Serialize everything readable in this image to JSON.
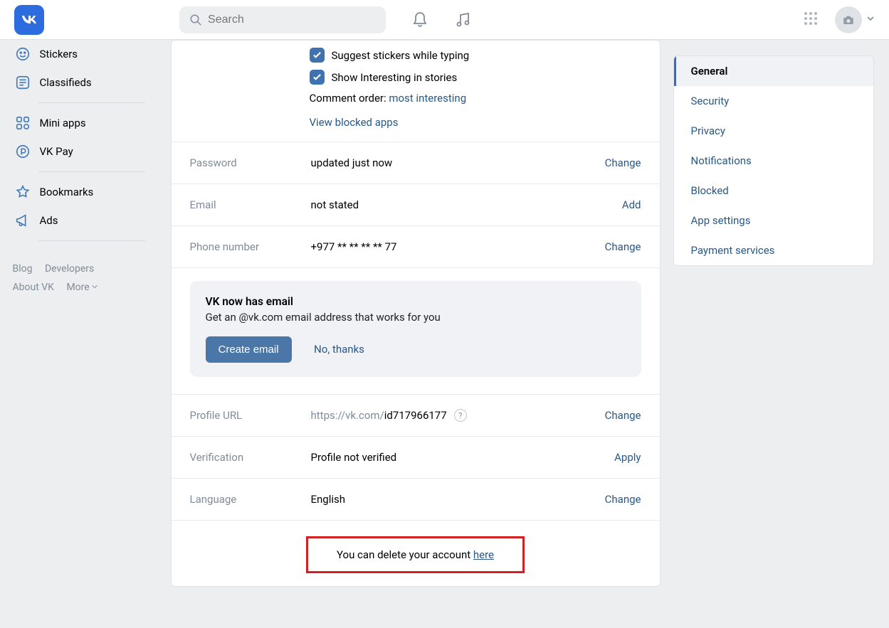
{
  "search": {
    "placeholder": "Search"
  },
  "leftnav": {
    "stickers": "Stickers",
    "classifieds": "Classifieds",
    "miniapps": "Mini apps",
    "vkpay": "VK Pay",
    "bookmarks": "Bookmarks",
    "ads": "Ads"
  },
  "footer": {
    "blog": "Blog",
    "developers": "Developers",
    "about": "About VK",
    "more": "More"
  },
  "opts": {
    "suggest_stickers": "Suggest stickers while typing",
    "show_interesting": "Show Interesting in stories",
    "comment_order_label": "Comment order: ",
    "comment_order_value": "most interesting",
    "view_blocked": "View blocked apps"
  },
  "rows": {
    "password": {
      "label": "Password",
      "value": "updated just now",
      "action": "Change"
    },
    "email": {
      "label": "Email",
      "value": "not stated",
      "action": "Add"
    },
    "phone": {
      "label": "Phone number",
      "value": "+977 ** ** ** ** 77",
      "action": "Change"
    },
    "url": {
      "label": "Profile URL",
      "prefix": "https://vk.com/",
      "id": "id717966177",
      "action": "Change"
    },
    "verify": {
      "label": "Verification",
      "value": "Profile not verified",
      "action": "Apply"
    },
    "lang": {
      "label": "Language",
      "value": "English",
      "action": "Change"
    }
  },
  "promo": {
    "title": "VK now has email",
    "body": "Get an @vk.com email address that works for you",
    "btn": "Create email",
    "decline": "No, thanks"
  },
  "delete": {
    "prefix": "You can delete your account ",
    "link": "here"
  },
  "rnav": {
    "general": "General",
    "security": "Security",
    "privacy": "Privacy",
    "notifications": "Notifications",
    "blocked": "Blocked",
    "app": "App settings",
    "payment": "Payment services"
  }
}
